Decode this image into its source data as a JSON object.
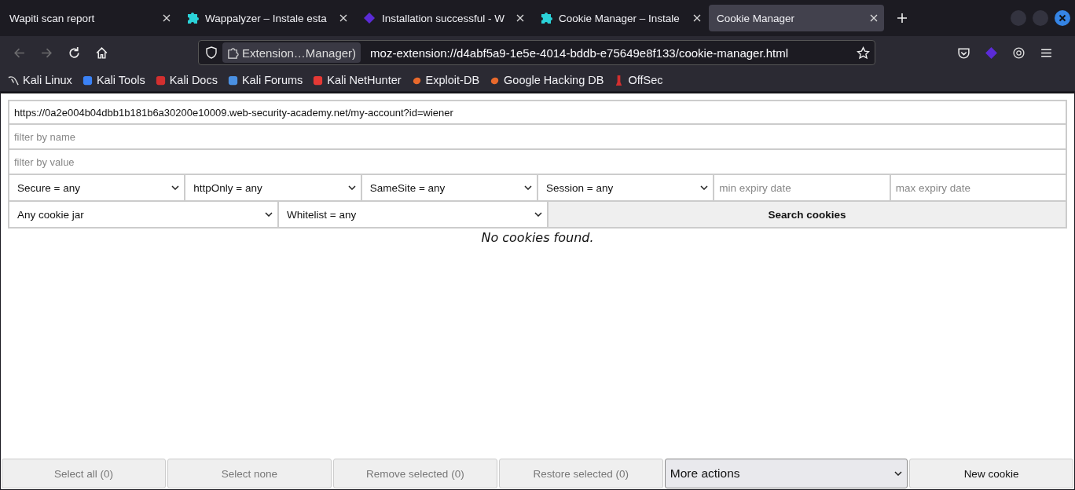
{
  "tabs": [
    {
      "title": "Wapiti scan report",
      "selected": false
    },
    {
      "title": "Wappalyzer – Instale esta",
      "selected": false
    },
    {
      "title": "Installation successful - W",
      "selected": false
    },
    {
      "title": "Cookie Manager – Instale",
      "selected": false
    },
    {
      "title": "Cookie Manager",
      "selected": true
    }
  ],
  "address": {
    "identity": "Extension…Manager)",
    "url": "moz-extension://d4abf5a9-1e5e-4014-bddb-e75649e8f133/cookie-manager.html"
  },
  "bookmarks": [
    {
      "label": "Kali Linux"
    },
    {
      "label": "Kali Tools"
    },
    {
      "label": "Kali Docs"
    },
    {
      "label": "Kali Forums"
    },
    {
      "label": "Kali NetHunter"
    },
    {
      "label": "Exploit-DB"
    },
    {
      "label": "Google Hacking DB"
    },
    {
      "label": "OffSec"
    }
  ],
  "cookie_manager": {
    "url_field": {
      "value": "https://0a2e004b04dbb1b181b6a30200e10009.web-security-academy.net/my-account?id=wiener"
    },
    "name_filter": {
      "placeholder": "filter by name"
    },
    "value_filter": {
      "placeholder": "filter by value"
    },
    "filters": [
      {
        "kind": "select",
        "value": "Secure = any"
      },
      {
        "kind": "select",
        "value": "httpOnly = any"
      },
      {
        "kind": "select",
        "value": "SameSite = any"
      },
      {
        "kind": "select",
        "value": "Session = any"
      },
      {
        "kind": "input",
        "placeholder": "min expiry date"
      },
      {
        "kind": "input",
        "placeholder": "max expiry date"
      }
    ],
    "jar_select": {
      "value": "Any cookie jar"
    },
    "whitelist_select": {
      "value": "Whitelist = any"
    },
    "search_button": "Search cookies",
    "message": "No cookies found."
  },
  "actions": [
    {
      "kind": "button",
      "label": "Select all (0)",
      "disabled": true
    },
    {
      "kind": "button",
      "label": "Select none",
      "disabled": true
    },
    {
      "kind": "button",
      "label": "Remove selected (0)",
      "disabled": true
    },
    {
      "kind": "button",
      "label": "Restore selected (0)",
      "disabled": true
    },
    {
      "kind": "select",
      "label": "More actions",
      "disabled": false
    },
    {
      "kind": "button",
      "label": "New cookie",
      "disabled": false
    }
  ]
}
